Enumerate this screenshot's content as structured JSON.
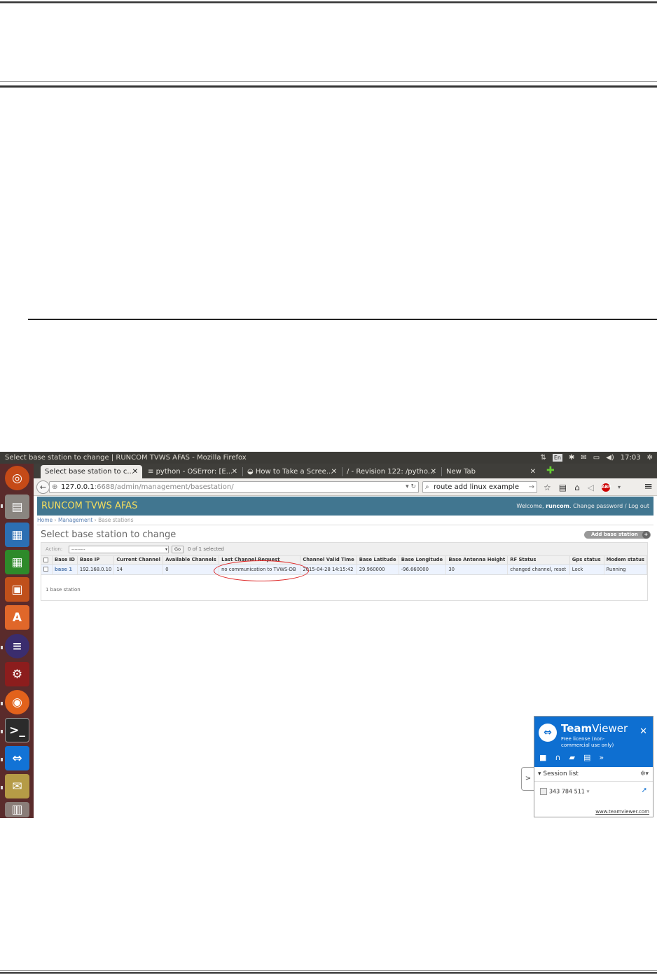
{
  "window": {
    "title": "Select base station to change | RUNCOM TVWS AFAS - Mozilla Firefox",
    "tray": {
      "keyboard": "En",
      "clock": "17:03"
    }
  },
  "launcher": {
    "items": [
      "ubuntu-dash-icon",
      "files-icon",
      "writer-icon",
      "calc-icon",
      "impress-icon",
      "software-center-icon",
      "eclipse-icon",
      "settings-icon",
      "firefox-icon",
      "terminal-icon",
      "teamviewer-icon",
      "mail-icon",
      "trash-icon"
    ]
  },
  "tabs": [
    {
      "label": "Select base station to c...",
      "active": true
    },
    {
      "label": "python - OSError: [E..."
    },
    {
      "label": "How to Take a Scree..."
    },
    {
      "label": "/ - Revision 122: /pytho..."
    },
    {
      "label": "New Tab"
    }
  ],
  "nav": {
    "url_host": "127.0.0.1",
    "url_path": ":6688/admin/management/basestation/",
    "search_value": "route add linux example"
  },
  "admin": {
    "brand": "RUNCOM TVWS AFAS",
    "welcome": "Welcome,",
    "username": "runcom",
    "change_password": "Change password",
    "slash": "/",
    "logout": "Log out",
    "breadcrumbs": {
      "home": "Home",
      "sep": "›",
      "management": "Management",
      "current": "Base stations"
    },
    "title": "Select base station to change",
    "add_button": "Add base station",
    "action_label": "Action:",
    "action_value": "---------",
    "go": "Go",
    "selected_count": "0 of 1 selected",
    "columns": [
      "Base ID",
      "Base IP",
      "Current Channel",
      "Available Channels",
      "Last Channel Request",
      "Channel Valid Time",
      "Base Latitude",
      "Base Longitude",
      "Base Antenna Height",
      "RF Status",
      "Gps status",
      "Modem status"
    ],
    "rows": [
      [
        "base 1",
        "192.168.0.10",
        "14",
        "0",
        "no communication to TVWS-DB",
        "2015-04-28 14:15:42",
        "29.960000",
        "-96.660000",
        "30",
        "changed channel, reset",
        "Lock",
        "Running"
      ]
    ],
    "paginator": "1 base station"
  },
  "teamviewer": {
    "name_bold": "Team",
    "name_rest": "Viewer",
    "license": "Free license (non-commercial use only)",
    "session_list": "Session list",
    "partner_id": "343 784 511",
    "url": "www.teamviewer.com"
  }
}
